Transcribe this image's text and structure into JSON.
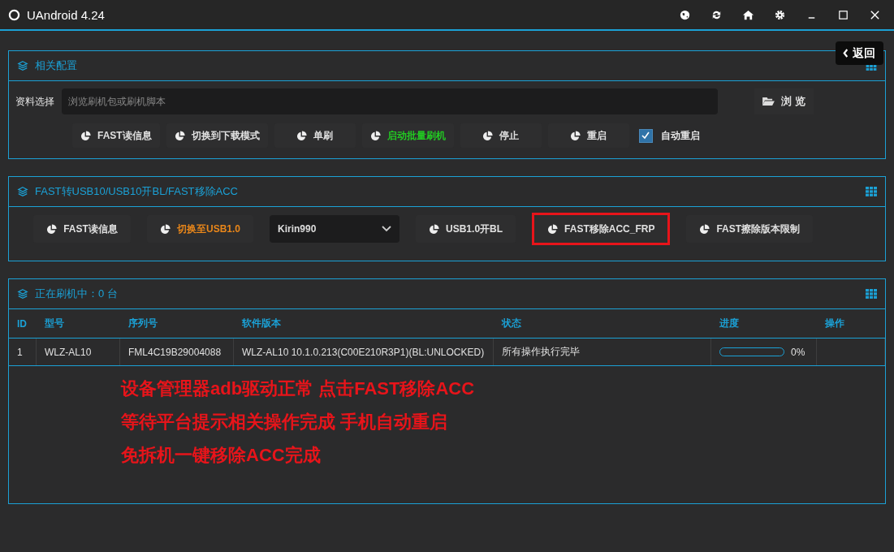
{
  "window": {
    "title": "UAndroid 4.24"
  },
  "back_button": {
    "label": "返回"
  },
  "config_panel": {
    "title": "相关配置",
    "file_label": "资料选择",
    "file_field": {
      "placeholder": "浏览刷机包或刷机脚本"
    },
    "browse_button": "浏 览",
    "buttons": [
      {
        "label": "FAST读信息",
        "color": "#e0e0e0"
      },
      {
        "label": "切换到下载模式",
        "color": "#e0e0e0"
      },
      {
        "label": "单刷",
        "color": "#e0e0e0"
      },
      {
        "label": "启动批量刷机",
        "color": "#22cc22"
      },
      {
        "label": "停止",
        "color": "#e0e0e0"
      },
      {
        "label": "重启",
        "color": "#e0e0e0"
      }
    ],
    "auto_restart": {
      "label": "自动重启",
      "checked": true
    }
  },
  "fast_panel": {
    "title": "FAST转USB10/USB10开BL/FAST移除ACC",
    "items": [
      {
        "kind": "button",
        "label": "FAST读信息",
        "color": "#e0e0e0",
        "highlighted": false
      },
      {
        "kind": "button",
        "label": "切换至USB1.0",
        "color": "#e8861a",
        "highlighted": false
      },
      {
        "kind": "select",
        "label": "Kirin990"
      },
      {
        "kind": "button",
        "label": "USB1.0开BL",
        "color": "#e0e0e0",
        "highlighted": false
      },
      {
        "kind": "button",
        "label": "FAST移除ACC_FRP",
        "highlighted": true
      },
      {
        "kind": "button",
        "label": "FAST擦除版本限制",
        "color": "#e0e0e0",
        "highlighted": false
      }
    ]
  },
  "flash_panel": {
    "title": "正在刷机中：0 台",
    "table": {
      "columns": [
        "ID",
        "型号",
        "序列号",
        "软件版本",
        "状态",
        "进度",
        "操作"
      ],
      "rows": [
        {
          "id": "1",
          "model": "WLZ-AL10",
          "serial": "FML4C19B29004088",
          "version": "WLZ-AL10 10.1.0.213(C00E210R3P1)(BL:UNLOCKED)",
          "status": "所有操作执行完毕",
          "level": 0,
          "progress": "0%"
        }
      ]
    }
  },
  "annotation": [
    "设备管理器adb驱动正常 点击FAST移除ACC",
    "等待平台提示相关操作完成 手机自动重启",
    "免拆机一键移除ACC完成"
  ]
}
